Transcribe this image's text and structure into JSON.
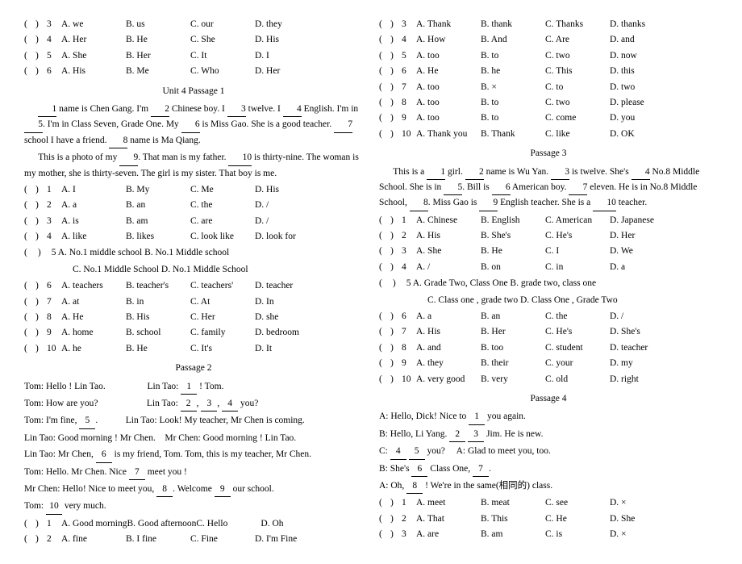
{
  "left_column": {
    "unit_header": "Unit  4    Passage  1",
    "passage1_intro": "1__ name is Chen Gang. I'm __2__ Chinese boy. I __3__ twelve. I __4__ English. I'm in __5__. I'm in Class Seven, Grade One. My __6__ is Miss Gao. She is a good teacher. __7__ school I have a friend. __8__ name is Ma Qiang.",
    "passage1_cont": "This is a photo of my __9__. That man is my father. __10__ is thirty-nine. The woman is my mother, she is thirty-seven. The girl is my sister. That boy is me.",
    "choices_p1": [
      {
        "num": "1",
        "A": "A. I",
        "B": "B. My",
        "C": "C. Me",
        "D": "D. His"
      },
      {
        "num": "2",
        "A": "A. a",
        "B": "B. an",
        "C": "C. the",
        "D": "D. /"
      },
      {
        "num": "3",
        "A": "A. is",
        "B": "B. am",
        "C": "C. are",
        "D": "D. /"
      },
      {
        "num": "4",
        "A": "A. like",
        "B": "B. likes",
        "C": "C. look like",
        "D": "D. look for"
      },
      {
        "num": "5",
        "special": true,
        "A": "A. No.1 middle school",
        "B": "B. No.1 Middle school",
        "C": "C. No.1 Middle School",
        "D": "D. No.1 Middle School"
      },
      {
        "num": "6",
        "A": "A. teachers",
        "B": "B. teacher's",
        "C": "C. teachers'",
        "D": "D. teacher"
      },
      {
        "num": "7",
        "A": "A. at",
        "B": "B. in",
        "C": "C. At",
        "D": "D. In"
      },
      {
        "num": "8",
        "A": "A. He",
        "B": "B. His",
        "C": "C. Her",
        "D": "D. she"
      },
      {
        "num": "9",
        "A": "A. home",
        "B": "B. school",
        "C": "C. family",
        "D": "D. bedroom"
      },
      {
        "num": "10",
        "A": "A. he",
        "B": "B. He",
        "C": "C. It's",
        "D": "D. It"
      }
    ],
    "passage2_title": "Passage  2",
    "dialogue": [
      {
        "speaker": "Tom: Hello ! Lin Tao.",
        "content": "Lin Tao: __1__ ! Tom."
      },
      {
        "speaker": "Tom: How are you?",
        "content": "Lin Tao: __2__, __3__, __4__ you?"
      },
      {
        "speaker": "Tom: I'm fine, __5__.",
        "content": "Lin Tao: Look! My teacher, Mr Chen is coming."
      },
      {
        "speaker": "Lin Tao: Good morning ! Mr Chen.",
        "content": "Mr Chen: Good morning ! Lin Tao."
      },
      {
        "speaker": "Lin Tao: Mr Chen, __6__ is my friend, Tom. Tom, this is my teacher, Mr Chen.",
        "content": ""
      },
      {
        "speaker": "Tom: Hello. Mr Chen. Nice __7__ meet you !",
        "content": ""
      },
      {
        "speaker": "Mr Chen: Hello! Nice to meet you, __8__. Welcome __9__ our school.",
        "content": ""
      },
      {
        "speaker": "Tom: __10__ very much.",
        "content": ""
      }
    ],
    "choices_p2": [
      {
        "num": "1",
        "A": "A. Good morning",
        "B": "B. Good afternoon",
        "C": "C. Hello",
        "D": "D. Oh"
      },
      {
        "num": "2",
        "A": "A. fine",
        "B": "B. I fine",
        "C": "C. Fine",
        "D": "D. I'm Fine"
      }
    ]
  },
  "right_column": {
    "choices_top": [
      {
        "num": "3",
        "A": "A. Thank",
        "B": "B. thank",
        "C": "C. Thanks",
        "D": "D. thanks"
      },
      {
        "num": "4",
        "A": "A. How",
        "B": "B. And",
        "C": "C. Are",
        "D": "D. and"
      },
      {
        "num": "5",
        "A": "A. too",
        "B": "B. to",
        "C": "C. two",
        "D": "D. now"
      },
      {
        "num": "6",
        "A": "A. He",
        "B": "B. he",
        "C": "C. This",
        "D": "D. this"
      },
      {
        "num": "7",
        "A": "A. too",
        "B": "B. ×",
        "C": "C. to",
        "D": "D. two"
      },
      {
        "num": "8",
        "A": "A. too",
        "B": "B. to",
        "C": "C. two",
        "D": "D. please"
      },
      {
        "num": "9",
        "A": "A. too",
        "B": "B. to",
        "C": "C. come",
        "D": "D. you"
      },
      {
        "num": "10",
        "A": "A. Thank you",
        "B": "B. Thank",
        "C": "C. like",
        "D": "D. OK"
      }
    ],
    "passage3_title": "Passage  3",
    "passage3_text": "This is a __1__ girl. __2__ name is Wu Yan. __3__ is twelve. She's __4__ No.8 Middle School. She is in __5__. Bill is __6__ American boy. __7__ eleven. He is in No.8 Middle School, __8__. Miss Gao is __9__ English teacher. She is a __10__ teacher.",
    "choices_p3": [
      {
        "num": "1",
        "A": "A. Chinese",
        "B": "B. English",
        "C": "C. American",
        "D": "D. Japanese"
      },
      {
        "num": "2",
        "A": "A. His",
        "B": "B. She's",
        "C": "C. He's",
        "D": "D. Her"
      },
      {
        "num": "3",
        "A": "A. She",
        "B": "B. He",
        "C": "C. I",
        "D": "D. We"
      },
      {
        "num": "4",
        "A": "A. /",
        "B": "B. on",
        "C": "C. in",
        "D": "D. a"
      },
      {
        "num": "5",
        "special": true,
        "A": "A. Grade Two, Class One",
        "B": "B. grade two, class one",
        "C": "C. Class one , grade two",
        "D": "D. Class One , Grade Two"
      },
      {
        "num": "6",
        "A": "A. a",
        "B": "B. an",
        "C": "C. the",
        "D": "D. /"
      },
      {
        "num": "7",
        "A": "A. His",
        "B": "B. Her",
        "C": "C. He's",
        "D": "D. She's"
      },
      {
        "num": "8",
        "A": "A. and",
        "B": "B. too",
        "C": "C. student",
        "D": "D. teacher"
      },
      {
        "num": "9",
        "A": "A. they",
        "B": "B. their",
        "C": "C. your",
        "D": "D. my"
      },
      {
        "num": "10",
        "A": "A. very good",
        "B": "B. very",
        "C": "C. old",
        "D": "D. right"
      }
    ],
    "passage4_title": "Passage  4",
    "dialogue4": [
      "A: Hello, Dick! Nice to __1__ you again.",
      "B: Hello, Li Yang. __2__ __3__ Jim. He is new.",
      "C: __4__ __5__ you?  A: Glad to meet you, too.",
      "B: She's __6__ Class One, __7__.",
      "A: Oh, __8__ ! We're in the same(相同的) class."
    ],
    "choices_p4": [
      {
        "num": "1",
        "A": "A. meet",
        "B": "B. meat",
        "C": "C. see",
        "D": "D. ×"
      },
      {
        "num": "2",
        "A": "A. That",
        "B": "B. This",
        "C": "C. He",
        "D": "D. She"
      },
      {
        "num": "3",
        "A": "A. are",
        "B": "B. am",
        "C": "C. is",
        "D": "D. ×"
      }
    ]
  }
}
